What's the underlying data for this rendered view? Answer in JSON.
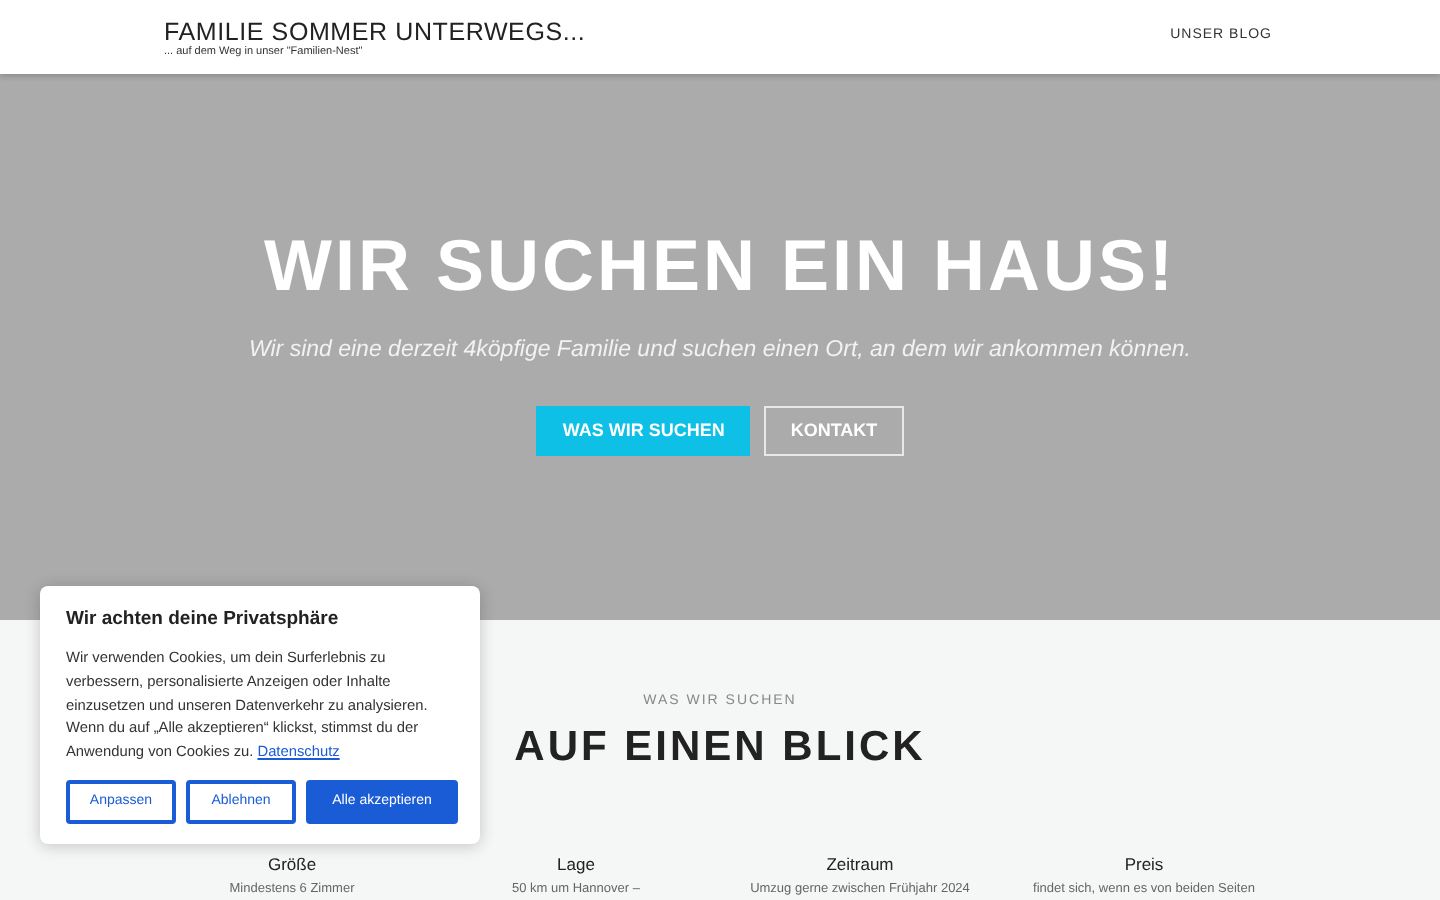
{
  "navbar": {
    "brand": "FAMILIE SOMMER UNTERWEGS...",
    "tagline": "... auf dem Weg in unser \"Familien-Nest\"",
    "links": [
      "UNSER BLOG"
    ]
  },
  "hero": {
    "title": "WIR SUCHEN EIN HAUS!",
    "subtitle": "Wir sind eine derzeit 4köpfige Familie und suchen einen Ort, an dem wir ankommen können.",
    "buttons": [
      {
        "label": "WAS WIR SUCHEN",
        "kind": "primary"
      },
      {
        "label": "KONTAKT",
        "kind": "outline"
      }
    ]
  },
  "section": {
    "overline": "WAS WIR SUCHEN",
    "title": "AUF EINEN BLICK",
    "columns": [
      {
        "title": "Größe",
        "text": "Mindestens 6 Zimmer"
      },
      {
        "title": "Lage",
        "text": "50 km um Hannover –"
      },
      {
        "title": "Zeitraum",
        "text": "Umzug gerne zwischen Frühjahr 2024"
      },
      {
        "title": "Preis",
        "text": "findet sich, wenn es von beiden Seiten"
      }
    ]
  },
  "cookie_banner": {
    "title": "Wir achten deine Privatsphäre",
    "text": "Wir verwenden Cookies, um dein Surferlebnis zu verbessern, personalisierte Anzeigen oder Inhalte einzusetzen und unseren Datenverkehr zu analysieren. Wenn du auf „Alle akzeptieren“ klickst, stimmst du der Anwendung von Cookies zu.",
    "link": "Datenschutz",
    "buttons": [
      {
        "label": "Anpassen",
        "kind": "outline"
      },
      {
        "label": "Ablehnen",
        "kind": "outline"
      },
      {
        "label": "Alle akzeptieren",
        "kind": "primary"
      }
    ]
  }
}
